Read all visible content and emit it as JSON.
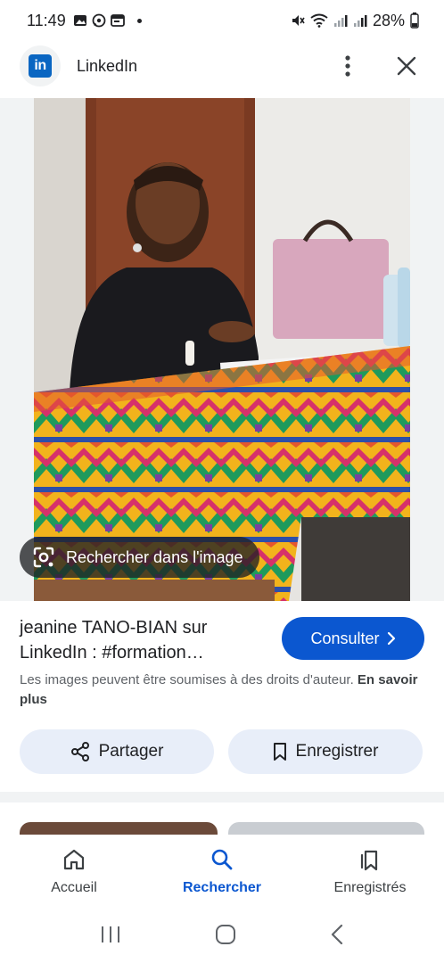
{
  "status_bar": {
    "time": "11:49",
    "battery": "28%",
    "icons_left": [
      "gallery-icon",
      "whatsapp-icon",
      "calendar-icon"
    ],
    "icons_right": [
      "mute-icon",
      "wifi-icon",
      "signal-icon",
      "signal-icon",
      "battery-icon"
    ]
  },
  "header": {
    "site_name": "LinkedIn",
    "logo_text": "in"
  },
  "image": {
    "lens_label": "Rechercher dans l'image"
  },
  "result": {
    "title": "jeanine TANO-BIAN sur LinkedIn : #formation…",
    "consult_label": "Consulter",
    "copyright_text": "Les images peuvent être soumises à des droits d'auteur.",
    "copyright_link": "En savoir plus"
  },
  "actions": {
    "share_label": "Partager",
    "save_label": "Enregistrer"
  },
  "bottom_nav": {
    "items": [
      {
        "label": "Accueil",
        "icon": "home-icon"
      },
      {
        "label": "Rechercher",
        "icon": "search-icon"
      },
      {
        "label": "Enregistrés",
        "icon": "saved-icon"
      }
    ]
  },
  "colors": {
    "accent": "#0b57d0",
    "chip_bg": "#e8eef9",
    "linkedin_blue": "#0a66c2"
  }
}
